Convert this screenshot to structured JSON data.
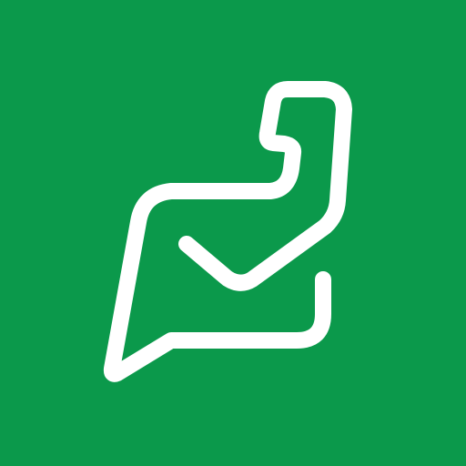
{
  "icon": {
    "name": "chat-bubble-checkmark-flexed-arm-logo",
    "background_color": "#0B994B",
    "stroke_color": "#FFFFFF"
  }
}
